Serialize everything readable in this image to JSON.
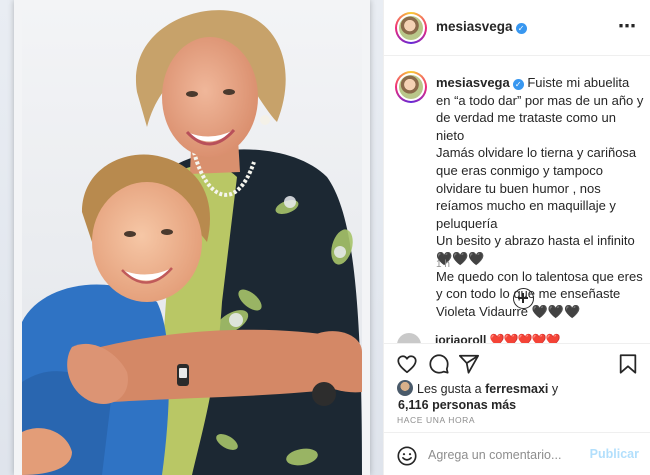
{
  "post": {
    "username": "mesiasvega",
    "verified_mark": "✓",
    "more_icon": "⋯"
  },
  "caption": {
    "username": "mesiasvega",
    "paragraphs": [
      "Fuiste mi abuelita en “a todo dar” por mas de un año y de verdad me trataste como un nieto",
      "Jamás olvidare lo tierna y cariñosa que eras conmigo y tampoco olvidare tu buen humor , nos reíamos mucho en maquillaje y peluquería",
      "Un besito y abrazo hasta el infinito",
      "🖤🖤🖤",
      "Me quedo con lo talentosa que eres y con todo lo que me enseñaste",
      "Violeta Vidaurre 🖤🖤🖤"
    ],
    "time_ago": "1 h"
  },
  "next_comment": {
    "username": "ioriaoroll",
    "hearts": "❤️❤️❤️❤️❤️"
  },
  "likes": {
    "prefix": "Les gusta a",
    "user": "ferresmaxi",
    "conjunction": "y",
    "count": "6,116 personas más"
  },
  "timestamp": "HACE UNA HORA",
  "comment_box": {
    "placeholder": "Agrega un comentario...",
    "publish_label": "Publicar"
  },
  "icons": {
    "like": "heart-icon",
    "comment": "comment-bubble-icon",
    "share": "paper-plane-icon",
    "save": "bookmark-icon",
    "emoji": "smiley-icon",
    "load_more": "plus-circle-icon"
  },
  "colors": {
    "verified": "#3897f0",
    "publish_disabled": "#b2dffc",
    "secondary_text": "#8e8e8e",
    "border": "#efefef"
  }
}
